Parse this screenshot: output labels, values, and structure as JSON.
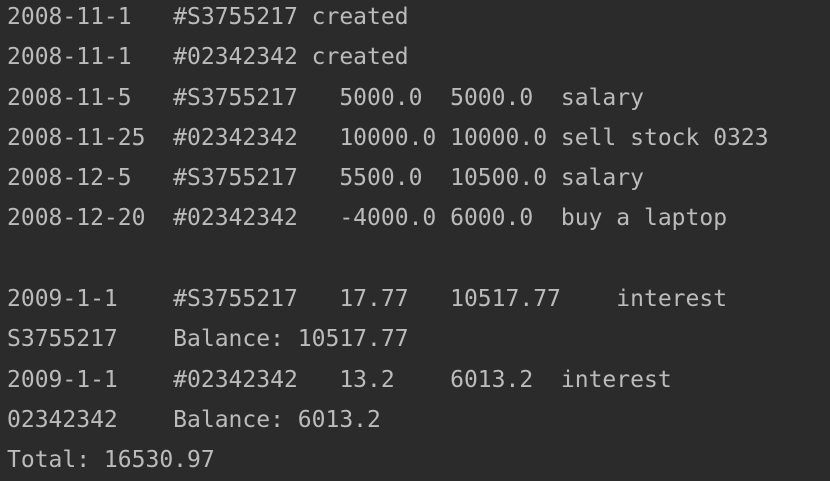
{
  "console": {
    "lines": [
      "2008-11-1   #S3755217 created",
      "2008-11-1   #02342342 created",
      "2008-11-5   #S3755217   5000.0  5000.0  salary",
      "2008-11-25  #02342342   10000.0 10000.0 sell stock 0323",
      "2008-12-5   #S3755217   5500.0  10500.0 salary",
      "2008-12-20  #02342342   -4000.0 6000.0  buy a laptop",
      "",
      "2009-1-1    #S3755217   17.77   10517.77    interest",
      "S3755217    Balance: 10517.77",
      "2009-1-1    #02342342   13.2    6013.2  interest",
      "02342342    Balance: 6013.2",
      "Total: 16530.97"
    ]
  }
}
